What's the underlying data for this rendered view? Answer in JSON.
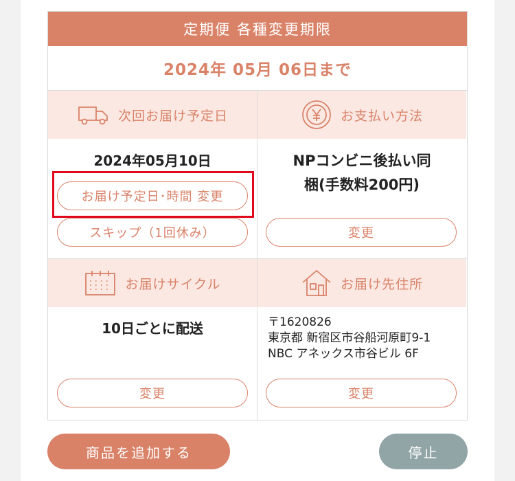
{
  "header": {
    "title": "定期便 各種変更期限"
  },
  "deadline": "2024年 05月 06日まで",
  "delivery": {
    "heading": "次回お届け予定日",
    "date": "2024年05月10日",
    "change_button": "お届け予定日･時間 変更",
    "skip_button": "スキップ（1回休み）"
  },
  "payment": {
    "heading": "お支払い方法",
    "method_line1": "NPコンビニ後払い同",
    "method_line2": "梱(手数料200円)",
    "change_button": "変更"
  },
  "cycle": {
    "heading": "お届けサイクル",
    "value": "10日ごとに配送",
    "change_button": "変更"
  },
  "address": {
    "heading": "お届け先住所",
    "postal": "〒1620826",
    "line1": "東京都 新宿区市谷船河原町9-1",
    "line2": "NBC アネックス市谷ビル 6F",
    "change_button": "変更"
  },
  "footer": {
    "add_product": "商品を追加する",
    "stop": "停止"
  },
  "colors": {
    "accent": "#d98268",
    "accent_light": "#fbe8e2",
    "stop_button": "#92a5a6",
    "highlight": "#e0091c"
  },
  "icons": [
    "truck-icon",
    "yen-icon",
    "calendar-icon",
    "house-icon"
  ]
}
